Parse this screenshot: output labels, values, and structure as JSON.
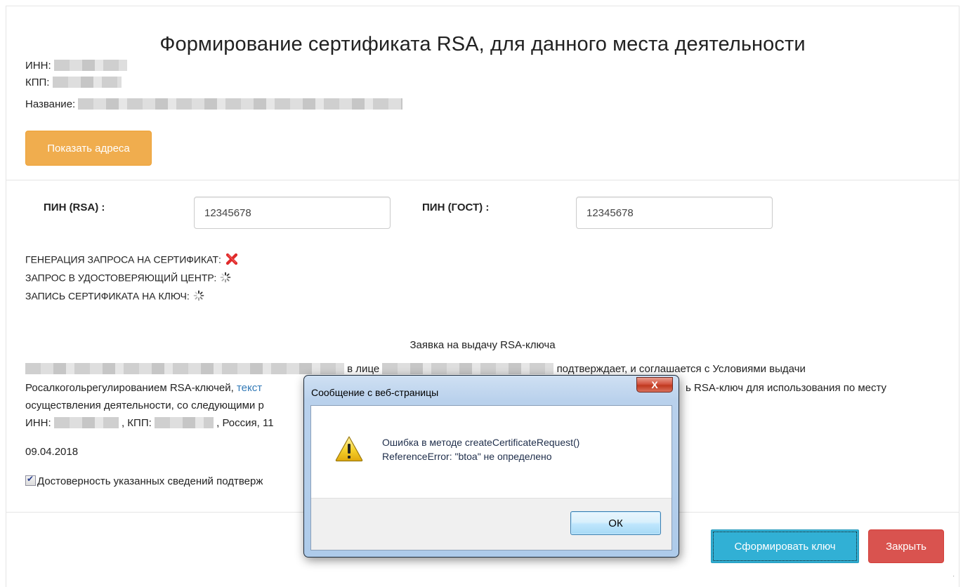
{
  "page": {
    "title": "Формирование сертификата RSA, для данного места деятельности",
    "inn_label": "ИНН:",
    "kpp_label": "КПП:",
    "name_label": "Название:",
    "show_addresses_button": "Показать адреса"
  },
  "pins": {
    "rsa_label": "ПИН (RSA) :",
    "rsa_value": "12345678",
    "gost_label": "ПИН (ГОСТ) :",
    "gost_value": "12345678"
  },
  "status": {
    "generation_label": "ГЕНЕРАЦИЯ ЗАПРОСА НА СЕРТИФИКАТ:",
    "generation_state": "error-icon",
    "request_label": "ЗАПРОС В УДОСТОВЕРЯЮЩИЙ ЦЕНТР:",
    "request_state": "loading-spinner-icon",
    "write_label": "ЗАПИСЬ СЕРТИФИКАТА НА КЛЮЧ:",
    "write_state": "loading-spinner-icon"
  },
  "application": {
    "heading": "Заявка на выдачу RSA-ключа",
    "line1_mid": "в лице",
    "line1_end": "подтверждает, и соглашается с Условиями выдачи",
    "line2_start": "Росалкогольрегулированием RSA-ключей,",
    "line2_link": "текст",
    "line2_end": "ь RSA-ключ для использования по месту",
    "line3_start": "осуществления деятельности, со следующими р",
    "line4_inn": "ИНН:",
    "line4_kpp": ", КПП:",
    "line4_end": ", Россия, 11",
    "date": "09.04.2018",
    "confirm_text": "Достоверность указанных сведений подтверж",
    "confirm_checked": true
  },
  "footer": {
    "generate_button": "Сформировать ключ",
    "close_button": "Закрыть"
  },
  "dialog": {
    "title": "Сообщение с веб-страницы",
    "close_glyph": "X",
    "message_line1": "Ошибка в методе createCertificateRequest()",
    "message_line2": "ReferenceError: \"btoa\" не определено",
    "ok_button": "ОК",
    "icon": "warning-icon"
  },
  "colors": {
    "orange": "#f0ad4e",
    "info_blue": "#31b0d5",
    "danger_red": "#d9534f",
    "link_blue": "#337ab7",
    "error_red": "#e02b2b"
  }
}
